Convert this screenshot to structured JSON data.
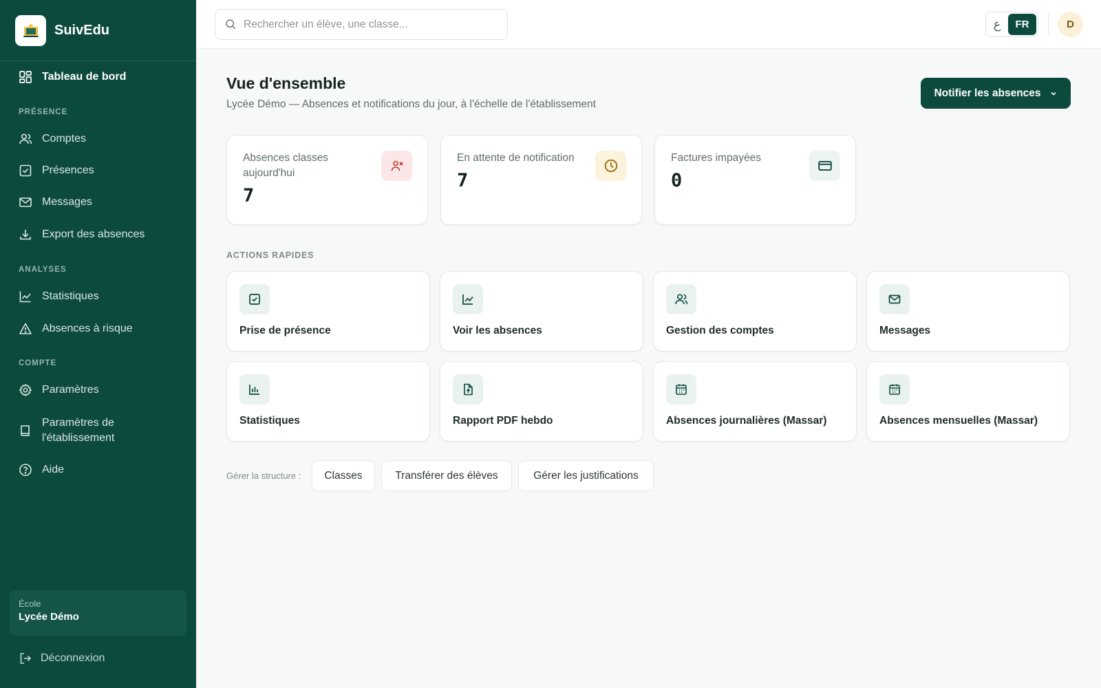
{
  "brand": {
    "name": "SuivEdu"
  },
  "sidebar": {
    "dashboard": "Tableau de bord",
    "sections": {
      "presence": "PRÉSENCE",
      "analyses": "ANALYSES",
      "compte": "COMPTE"
    },
    "items": {
      "comptes": "Comptes",
      "presences": "Présences",
      "messages": "Messages",
      "export": "Export des absences",
      "statistiques": "Statistiques",
      "absences_risque": "Absences à risque",
      "parametres": "Paramètres",
      "parametres_etab_1": "Paramètres de",
      "parametres_etab_2": "l'établissement",
      "aide": "Aide"
    },
    "school": {
      "label": "École",
      "name": "Lycée Démo"
    },
    "logout": "Déconnexion"
  },
  "topbar": {
    "search_placeholder": "Rechercher un élève, une classe...",
    "lang_ar": "ع",
    "lang_fr": "FR",
    "avatar_initial": "D"
  },
  "main": {
    "title": "Vue d'ensemble",
    "subtitle": "Lycée Démo — Absences et notifications du jour, à l'échelle de l'établissement",
    "notify_button": "Notifier les absences"
  },
  "stats": [
    {
      "label": "Absences classes aujourd'hui",
      "value": "7",
      "icon": "user-x-icon",
      "color": "#fbe7e7"
    },
    {
      "label": "En attente de notification",
      "value": "7",
      "icon": "clock-icon",
      "color": "#fcf3dc"
    },
    {
      "label": "Factures impayées",
      "value": "0",
      "icon": "credit-card-icon",
      "color": "#eef4f2"
    }
  ],
  "quick_actions": {
    "title": "ACTIONS RAPIDES",
    "items": [
      {
        "label": "Prise de présence",
        "icon": "check-square-icon"
      },
      {
        "label": "Voir les absences",
        "icon": "line-chart-icon"
      },
      {
        "label": "Gestion des comptes",
        "icon": "users-icon"
      },
      {
        "label": "Messages",
        "icon": "mail-icon"
      },
      {
        "label": "Statistiques",
        "icon": "bar-chart-icon"
      },
      {
        "label": "Rapport PDF hebdo",
        "icon": "file-upload-icon"
      },
      {
        "label": "Absences journalières (Massar)",
        "icon": "calendar-icon"
      },
      {
        "label": "Absences mensuelles (Massar)",
        "icon": "calendar-icon"
      }
    ]
  },
  "structure": {
    "label": "Gérer la structure :",
    "chips": [
      "Classes",
      "Transférer des élèves",
      "Gérer les justifications"
    ]
  },
  "colors": {
    "primary": "#0d4a3e",
    "accent_icon": "#0d4a3e"
  }
}
